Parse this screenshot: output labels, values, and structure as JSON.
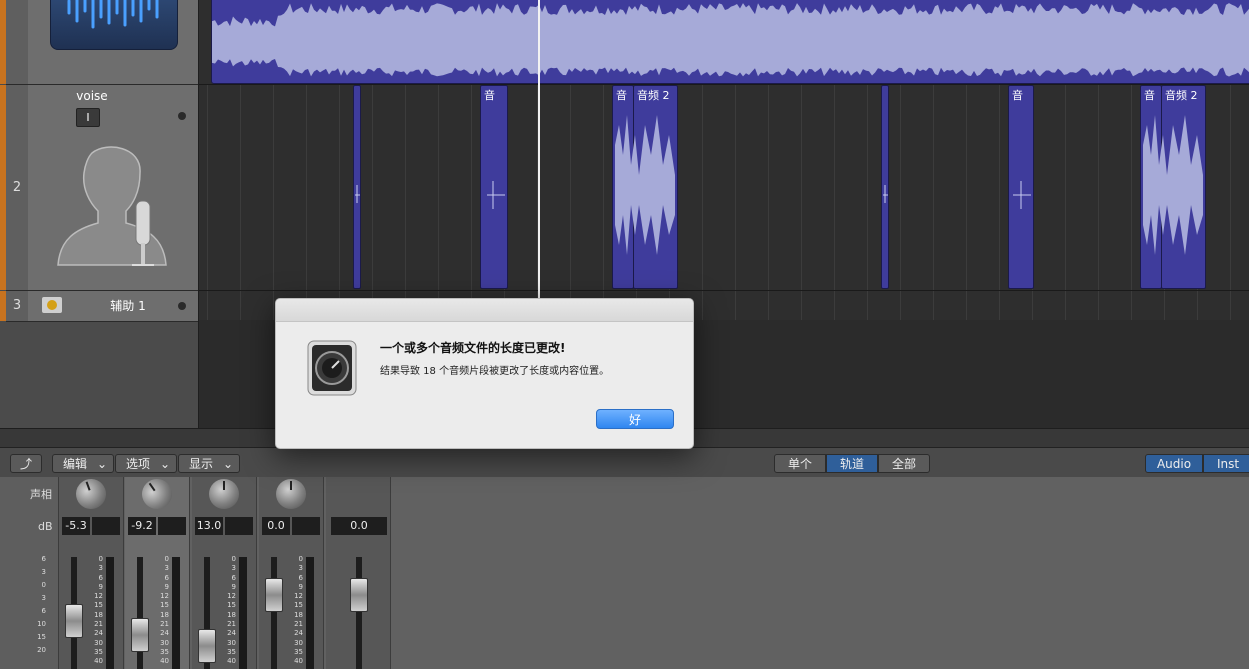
{
  "tracks": [
    {
      "number": "",
      "name": ""
    },
    {
      "number": "2",
      "name": "voise",
      "input_label": "I"
    },
    {
      "number": "3",
      "name": "辅助 1"
    }
  ],
  "regions": [
    {
      "label": ""
    },
    {
      "label": "音"
    },
    {
      "label": "音"
    },
    {
      "label": "音频 2"
    },
    {
      "label": ""
    },
    {
      "label": "音"
    },
    {
      "label": "音"
    },
    {
      "label": "音频 2"
    }
  ],
  "dialog": {
    "title": "一个或多个音频文件的长度已更改!",
    "message": "结果导致 18 个音频片段被更改了长度或内容位置。",
    "ok_button": "好",
    "icon": "logic-pro-app-icon"
  },
  "mixer_toolbar": {
    "menus": [
      "编辑",
      "选项",
      "显示"
    ],
    "view_segments": [
      "单个",
      "轨道",
      "全部"
    ],
    "selected_view": "轨道",
    "type_segments": [
      "Audio",
      "Inst"
    ]
  },
  "mixer": {
    "pan_label": "声相",
    "db_label": "dB",
    "channels": [
      {
        "db": "-5.3"
      },
      {
        "db": "-9.2"
      },
      {
        "db": "13.0"
      },
      {
        "db": "0.0"
      },
      {
        "db": "0.0"
      }
    ],
    "fader_scale": [
      "6",
      "3",
      "0",
      "3",
      "6",
      "10",
      "15",
      "20"
    ],
    "meter_scale": [
      "0",
      "3",
      "6",
      "9",
      "12",
      "15",
      "18",
      "21",
      "24",
      "30",
      "35",
      "40"
    ]
  },
  "colors": {
    "track_strip": "#c8731f",
    "region": "#3f3c9c",
    "waveform": "#a6aad8",
    "primary_button": "#3b8ff0"
  }
}
